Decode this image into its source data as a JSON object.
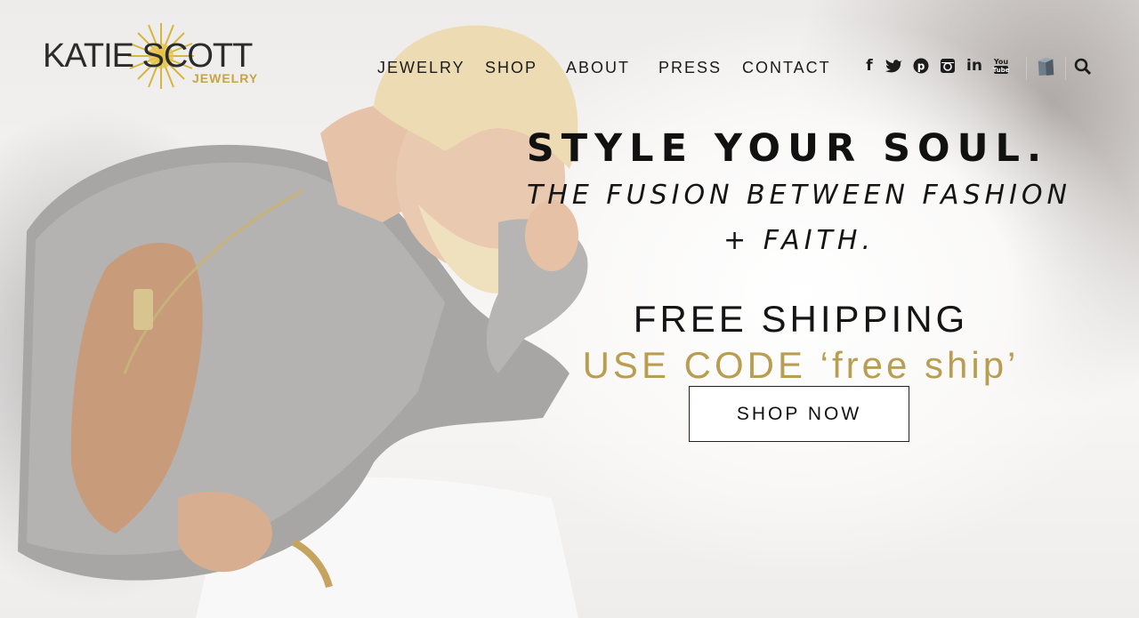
{
  "logo": {
    "name": "KATIE SCOTT",
    "sub": "JEWELRY"
  },
  "nav": {
    "items": [
      {
        "label": "JEWELRY"
      },
      {
        "label": "SHOP"
      },
      {
        "label": "ABOUT"
      },
      {
        "label": "PRESS"
      },
      {
        "label": "CONTACT"
      }
    ]
  },
  "social": {
    "icons": [
      {
        "name": "facebook-icon",
        "glyph": "f"
      },
      {
        "name": "twitter-icon",
        "glyph": "t"
      },
      {
        "name": "pinterest-icon",
        "glyph": "p"
      },
      {
        "name": "instagram-icon",
        "glyph": "◘"
      },
      {
        "name": "linkedin-icon",
        "glyph": "in"
      },
      {
        "name": "youtube-icon",
        "glyph": "▶"
      }
    ],
    "bag_icon": "shopping-bag-icon",
    "search_icon": "search-icon"
  },
  "hero": {
    "tagline": "STYLE YOUR SOUL.",
    "sub_line1": "THE FUSION BETWEEN FASHION",
    "sub_line2": "+ FAITH.",
    "shipping": "FREE SHIPPING",
    "code": "USE CODE ‘free ship’",
    "button": "SHOP NOW"
  },
  "colors": {
    "accent_gold": "#b99e52",
    "text_dark": "#111111"
  }
}
